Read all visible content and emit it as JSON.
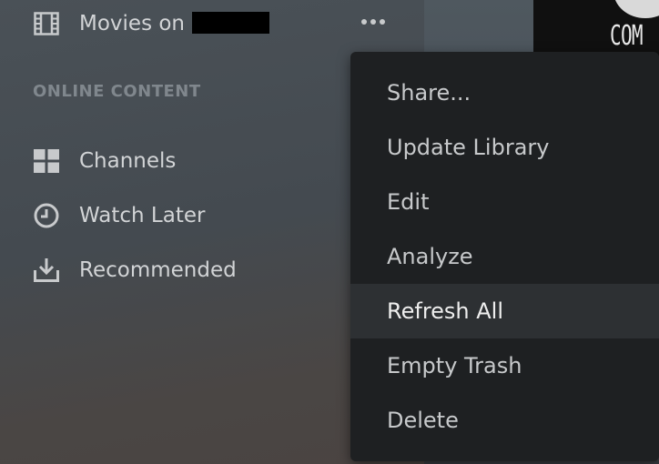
{
  "sidebar": {
    "library_item": {
      "label": "Movies on",
      "icon": "film-icon"
    },
    "section_title": "ONLINE CONTENT",
    "items": [
      {
        "label": "Channels",
        "icon": "grid-icon"
      },
      {
        "label": "Watch Later",
        "icon": "clock-icon"
      },
      {
        "label": "Recommended",
        "icon": "download-icon"
      }
    ]
  },
  "context_menu": {
    "items": [
      {
        "label": "Share..."
      },
      {
        "label": "Update Library"
      },
      {
        "label": "Edit"
      },
      {
        "label": "Analyze"
      },
      {
        "label": "Refresh All",
        "state": "hovered"
      },
      {
        "label": "Empty Trash"
      },
      {
        "label": "Delete"
      }
    ]
  },
  "poster": {
    "text": "COM"
  },
  "colors": {
    "menu_bg": "#1e2022",
    "menu_hover": "#2d3033",
    "text": "#d2d4d6",
    "section_title": "#80878d"
  }
}
